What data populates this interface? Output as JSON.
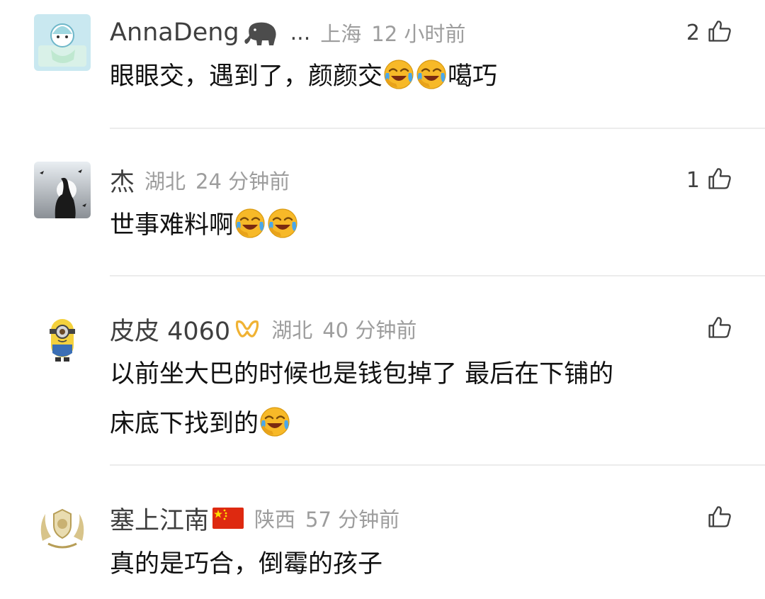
{
  "comments": [
    {
      "username": "AnnaDeng",
      "badge_icon": "elephant-icon",
      "more": "...",
      "location": "上海",
      "time": "12 小时前",
      "likes": "2",
      "text_parts": [
        "眼眼交，遇到了，颜颜交",
        "噶巧"
      ]
    },
    {
      "username": "杰",
      "location": "湖北",
      "time": "24 分钟前",
      "likes": "1",
      "text_parts": [
        "世事难料啊"
      ]
    },
    {
      "username": "皮皮 4060",
      "badge_icon": "vip-ribbon-icon",
      "location": "湖北",
      "time": "40 分钟前",
      "likes": "",
      "text_parts": [
        "以前坐大巴的时候也是钱包掉了 最后在下铺的",
        "床底下找到的"
      ]
    },
    {
      "username": "塞上江南",
      "badge_icon": "china-flag-icon",
      "location": "陕西",
      "time": "57 分钟前",
      "likes": "",
      "text_parts": [
        "真的是巧合，倒霉的孩子"
      ]
    }
  ],
  "emoji": "laugh-cry-emoji",
  "colors": {
    "username": "#3f3f3f",
    "meta": "#9d9d9d",
    "divider": "#ececec",
    "emoji_face": "#f7b928"
  }
}
